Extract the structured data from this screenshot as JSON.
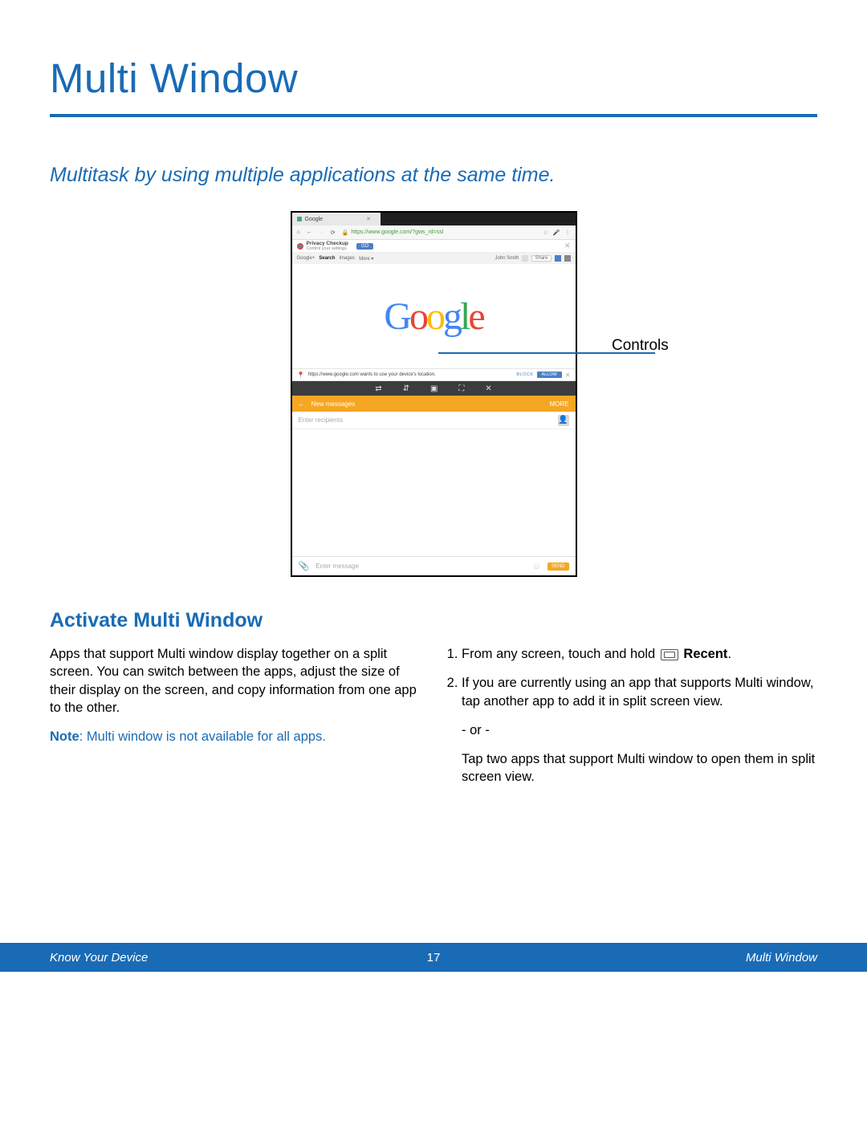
{
  "page": {
    "title": "Multi Window",
    "subtitle": "Multitask by using multiple applications at the same time.",
    "callout_label": "Controls",
    "section_heading": "Activate Multi Window",
    "para": "Apps that support Multi window display together on a split screen. You can switch between the apps, adjust the size of their display on the screen, and copy information from one app to the other.",
    "note_prefix": "Note",
    "note_body": ": Multi window is not available for all apps.",
    "step1_a": "From any screen, touch and hold ",
    "step1_b": "Recent",
    "step1_c": ".",
    "step2": "If you are currently using an app that supports Multi window, tap another app to add it in split screen view.",
    "or": "- or -",
    "step2b": "Tap two apps that support Multi window to open them in split screen view."
  },
  "device": {
    "tab_label": "Google",
    "url": "https://www.google.com/?gws_rd=ssl",
    "privacy_title": "Privacy Checkup",
    "privacy_sub": "Control your settings",
    "go": "GO",
    "nav_items": [
      "Google+",
      "Search",
      "Images",
      "More ▾"
    ],
    "user": "John Smith",
    "share": "Share",
    "logo_letters": [
      "G",
      "o",
      "o",
      "g",
      "l",
      "e"
    ],
    "location_text": "https://www.google.com wants to use your device's location.",
    "block": "BLOCK",
    "allow": "ALLOW",
    "control_icons": [
      "⇄",
      "⇵",
      "▣",
      "⛶",
      "✕"
    ],
    "new_messages": "New messages",
    "more": "MORE",
    "recipients_placeholder": "Enter recipients",
    "enter_message": "Enter message",
    "send": "SEND"
  },
  "footer": {
    "left": "Know Your Device",
    "page_number": "17",
    "right": "Multi Window"
  }
}
